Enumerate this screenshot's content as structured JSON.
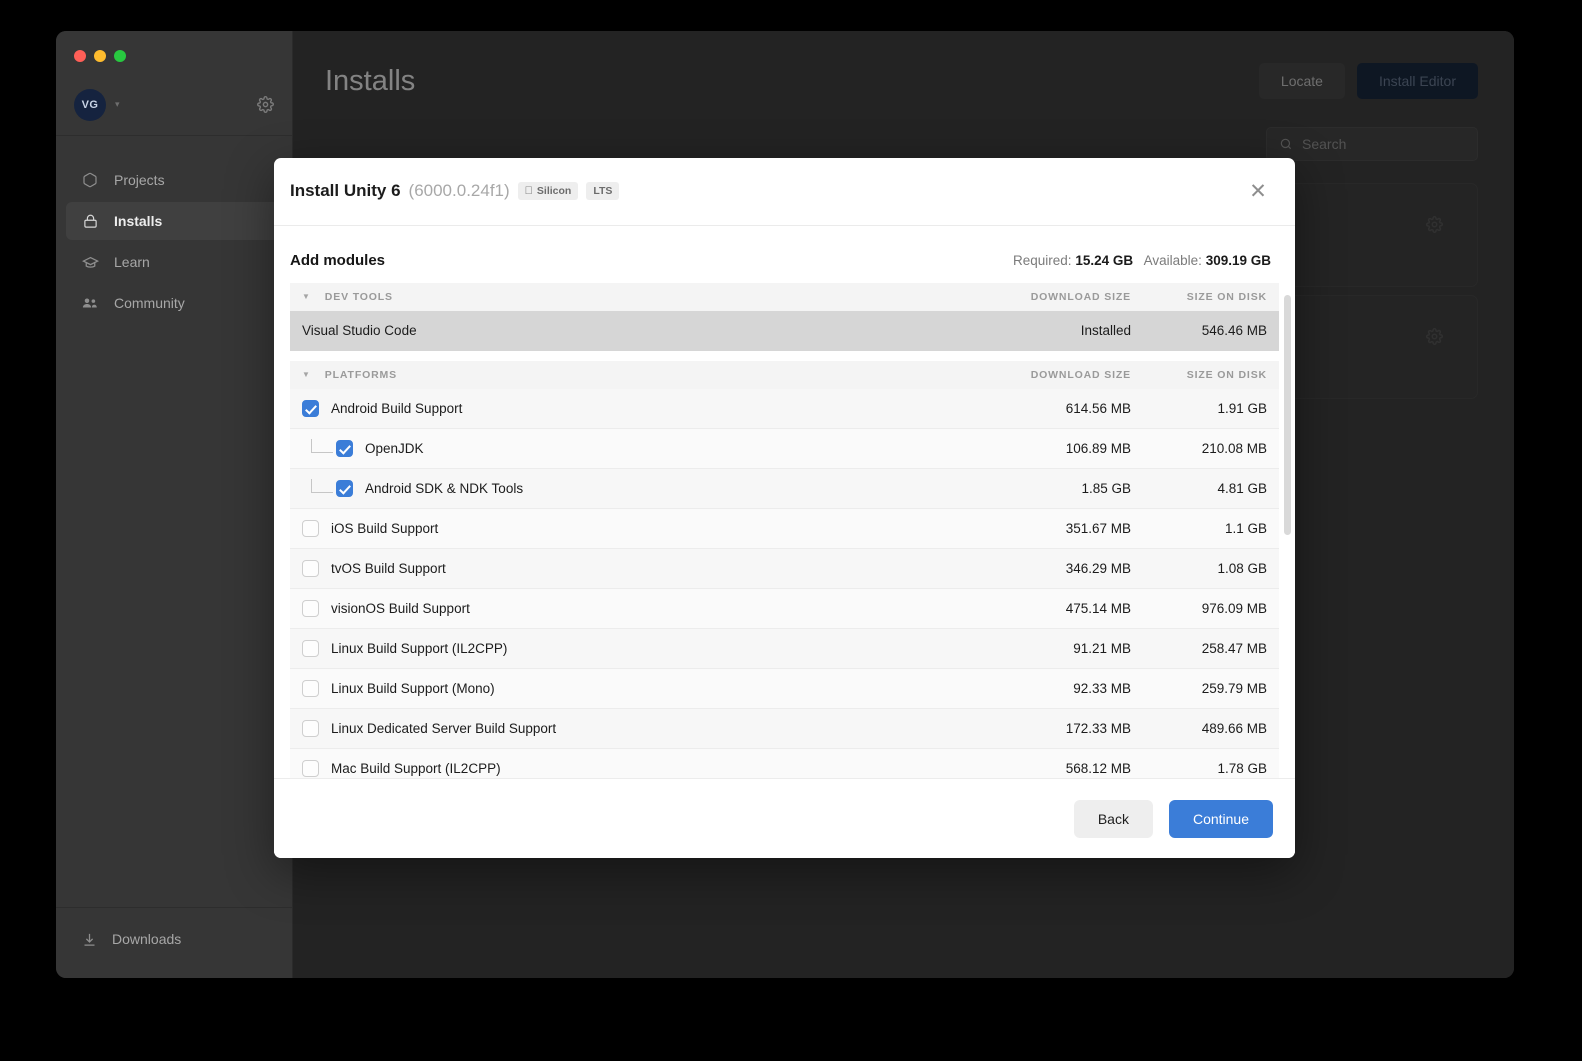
{
  "window": {
    "traffic_lights": [
      "close",
      "minimize",
      "maximize"
    ]
  },
  "sidebar": {
    "account": {
      "initials": "VG",
      "caret": "▾",
      "settings_icon": "gear-icon"
    },
    "items": [
      {
        "label": "Projects",
        "icon": "cube-icon",
        "active": false
      },
      {
        "label": "Installs",
        "icon": "install-icon",
        "active": true
      },
      {
        "label": "Learn",
        "icon": "graduation-icon",
        "active": false
      },
      {
        "label": "Community",
        "icon": "people-icon",
        "active": false
      }
    ],
    "footer": {
      "label": "Downloads",
      "icon": "download-icon"
    }
  },
  "main": {
    "title": "Installs",
    "locate_label": "Locate",
    "install_editor_label": "Install Editor",
    "search_placeholder": "Search",
    "search_value": "",
    "cards": [
      {
        "gear_icon": "gear-icon"
      },
      {
        "gear_icon": "gear-icon"
      }
    ]
  },
  "modal": {
    "title": "Install Unity 6",
    "version": "(6000.0.24f1)",
    "badges": [
      {
        "label": "Silicon",
        "icon": "apple-icon"
      },
      {
        "label": "LTS",
        "icon": ""
      }
    ],
    "close_icon": "close-icon",
    "add_modules_label": "Add modules",
    "size_info": {
      "required_label": "Required:",
      "required_value": "15.24 GB",
      "available_label": "Available:",
      "available_value": "309.19 GB"
    },
    "columns": {
      "download": "DOWNLOAD SIZE",
      "disk": "SIZE ON DISK"
    },
    "groups": [
      {
        "name": "DEV TOOLS",
        "expanded": true,
        "rows": [
          {
            "label": "Visual Studio Code",
            "download": "Installed",
            "disk": "546.46 MB",
            "checkbox": "none",
            "selected": true,
            "indent": 0
          }
        ]
      },
      {
        "name": "PLATFORMS",
        "expanded": true,
        "rows": [
          {
            "label": "Android Build Support",
            "download": "614.56 MB",
            "disk": "1.91 GB",
            "checkbox": "checked",
            "selected": false,
            "indent": 0
          },
          {
            "label": "OpenJDK",
            "download": "106.89 MB",
            "disk": "210.08 MB",
            "checkbox": "checked",
            "selected": false,
            "indent": 1
          },
          {
            "label": "Android SDK & NDK Tools",
            "download": "1.85 GB",
            "disk": "4.81 GB",
            "checkbox": "checked",
            "selected": false,
            "indent": 1
          },
          {
            "label": "iOS Build Support",
            "download": "351.67 MB",
            "disk": "1.1 GB",
            "checkbox": "unchecked",
            "selected": false,
            "indent": 0
          },
          {
            "label": "tvOS Build Support",
            "download": "346.29 MB",
            "disk": "1.08 GB",
            "checkbox": "unchecked",
            "selected": false,
            "indent": 0
          },
          {
            "label": "visionOS Build Support",
            "download": "475.14 MB",
            "disk": "976.09 MB",
            "checkbox": "unchecked",
            "selected": false,
            "indent": 0
          },
          {
            "label": "Linux Build Support (IL2CPP)",
            "download": "91.21 MB",
            "disk": "258.47 MB",
            "checkbox": "unchecked",
            "selected": false,
            "indent": 0
          },
          {
            "label": "Linux Build Support (Mono)",
            "download": "92.33 MB",
            "disk": "259.79 MB",
            "checkbox": "unchecked",
            "selected": false,
            "indent": 0
          },
          {
            "label": "Linux Dedicated Server Build Support",
            "download": "172.33 MB",
            "disk": "489.66 MB",
            "checkbox": "unchecked",
            "selected": false,
            "indent": 0
          },
          {
            "label": "Mac Build Support (IL2CPP)",
            "download": "568.12 MB",
            "disk": "1.78 GB",
            "checkbox": "unchecked",
            "selected": false,
            "indent": 0
          }
        ]
      }
    ],
    "footer": {
      "back_label": "Back",
      "continue_label": "Continue"
    }
  },
  "colors": {
    "accent_blue": "#3b7dd8",
    "window_bg": "#323232",
    "sidebar_bg": "#363636",
    "modal_bg": "#ffffff",
    "selected_row": "#d6d6d6"
  }
}
